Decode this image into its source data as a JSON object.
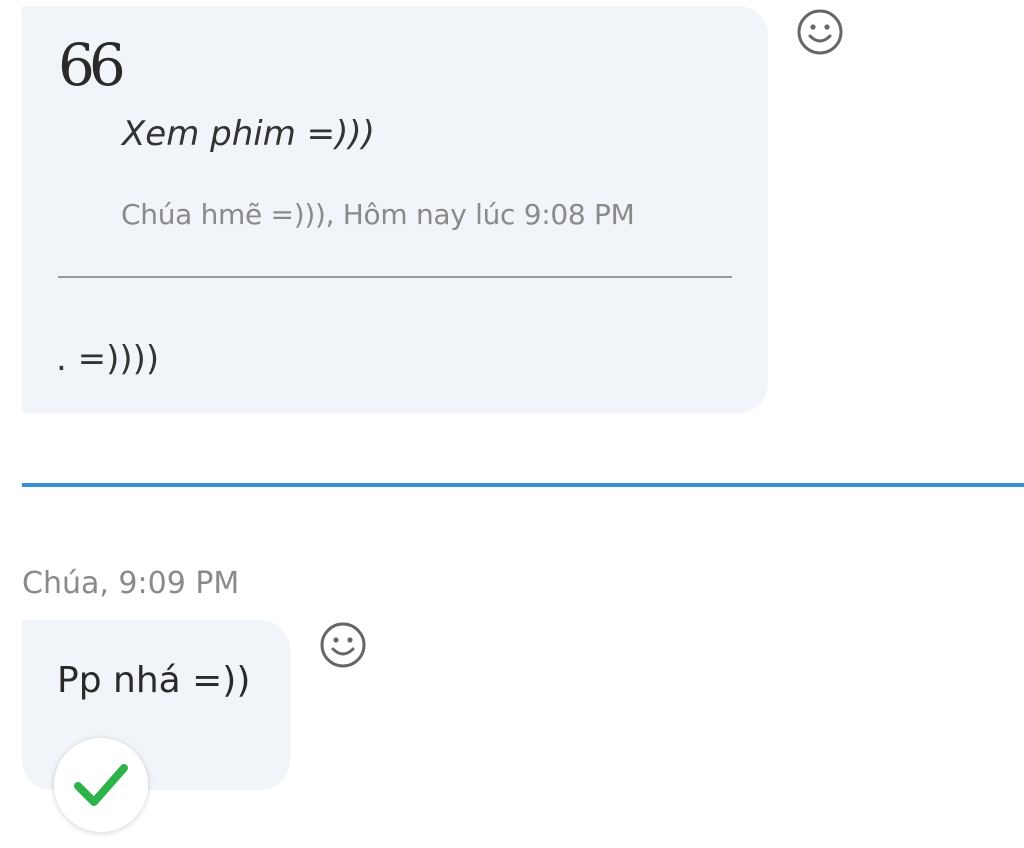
{
  "quoted_message": {
    "quote_icon": "quote-icon",
    "quote_glyph": "66",
    "quoted_text": "Xem phim =)))",
    "quoted_meta": "Chúa hmẽ =))), Hôm nay lúc 9:08 PM",
    "reply_text": ". =))))"
  },
  "new_messages_divider": {
    "color": "#3a8edb"
  },
  "message": {
    "sender_time": "Chúa, 9:09 PM",
    "text": "Pp nhá =))",
    "seen_icon": "checkmark-icon",
    "seen_color": "#2db34a"
  },
  "reactions": {
    "icon": "smiley-icon"
  }
}
